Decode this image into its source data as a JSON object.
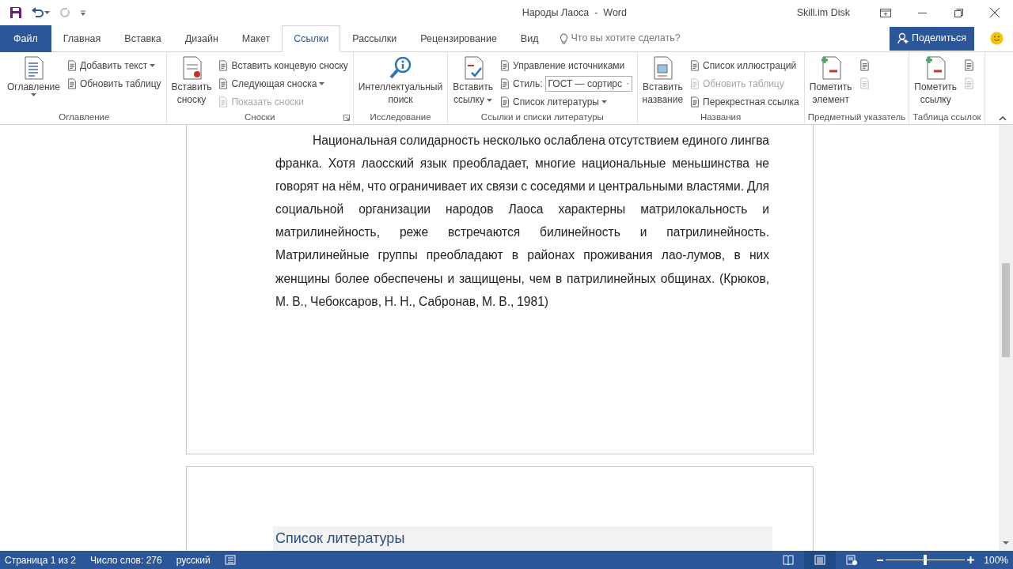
{
  "window": {
    "title": "Народы Лаоса  -  Word",
    "account": "Skill.im Disk"
  },
  "tabs": [
    {
      "label": "Файл",
      "kind": "file",
      "selected": false
    },
    {
      "label": "Главная",
      "kind": "tab",
      "selected": false
    },
    {
      "label": "Вставка",
      "kind": "tab",
      "selected": false
    },
    {
      "label": "Дизайн",
      "kind": "tab",
      "selected": false
    },
    {
      "label": "Макет",
      "kind": "tab",
      "selected": false
    },
    {
      "label": "Ссылки",
      "kind": "tab",
      "selected": true
    },
    {
      "label": "Рассылки",
      "kind": "tab",
      "selected": false
    },
    {
      "label": "Рецензирование",
      "kind": "tab",
      "selected": false
    },
    {
      "label": "Вид",
      "kind": "tab",
      "selected": false
    }
  ],
  "tell_me": {
    "placeholder": "Что вы хотите сделать?"
  },
  "share_button": "Поделиться",
  "ribbon": [
    {
      "label": "Оглавление",
      "launcher": false,
      "columns": [
        {
          "kind": "large",
          "label": "Оглавление",
          "dropdown": true,
          "disabled": false
        },
        {
          "kind": "stack",
          "items": [
            {
              "label": "Добавить текст",
              "dropdown": true,
              "disabled": false
            },
            {
              "label": "Обновить таблицу",
              "dropdown": false,
              "disabled": false
            }
          ]
        }
      ]
    },
    {
      "label": "Сноски",
      "launcher": true,
      "columns": [
        {
          "kind": "large",
          "label": "Вставить\nсноску",
          "dropdown": false,
          "disabled": false
        },
        {
          "kind": "stack",
          "items": [
            {
              "label": "Вставить концевую сноску",
              "dropdown": false,
              "disabled": false
            },
            {
              "label": "Следующая сноска",
              "dropdown": true,
              "disabled": false
            },
            {
              "label": "Показать сноски",
              "dropdown": false,
              "disabled": true
            }
          ]
        }
      ]
    },
    {
      "label": "Исследование",
      "launcher": false,
      "columns": [
        {
          "kind": "large",
          "label": "Интеллектуальный\nпоиск",
          "dropdown": false,
          "disabled": false
        }
      ]
    },
    {
      "label": "Ссылки и списки литературы",
      "launcher": false,
      "columns": [
        {
          "kind": "large",
          "label": "Вставить\nссылку",
          "dropdown": true,
          "disabled": false
        },
        {
          "kind": "stack",
          "items": [
            {
              "label": "Управление источниками",
              "dropdown": false,
              "disabled": false
            },
            {
              "label": "Стиль:",
              "kind": "combo",
              "value": "ГОСТ — сортирс"
            },
            {
              "label": "Список литературы",
              "dropdown": true,
              "disabled": false
            }
          ]
        }
      ]
    },
    {
      "label": "Названия",
      "launcher": false,
      "columns": [
        {
          "kind": "large",
          "label": "Вставить\nназвание",
          "dropdown": false,
          "disabled": false
        },
        {
          "kind": "stack",
          "items": [
            {
              "label": "Список иллюстраций",
              "dropdown": false,
              "disabled": false
            },
            {
              "label": "Обновить таблицу",
              "dropdown": false,
              "disabled": true
            },
            {
              "label": "Перекрестная ссылка",
              "dropdown": false,
              "disabled": false
            }
          ]
        }
      ]
    },
    {
      "label": "Предметный указатель",
      "launcher": false,
      "columns": [
        {
          "kind": "large",
          "label": "Пометить\nэлемент",
          "dropdown": false,
          "disabled": false
        },
        {
          "kind": "icons",
          "items": [
            {
              "disabled": false
            },
            {
              "disabled": true
            }
          ]
        }
      ]
    },
    {
      "label": "Таблица ссылок",
      "launcher": false,
      "columns": [
        {
          "kind": "large",
          "label": "Пометить\nссылку",
          "dropdown": false,
          "disabled": false
        },
        {
          "kind": "icons",
          "items": [
            {
              "disabled": false
            },
            {
              "disabled": true
            }
          ]
        }
      ]
    }
  ],
  "document": {
    "paragraph": "Национальная солидарность несколько ослаблена отсутствием единого лингва франка. Хотя лаосский язык преобладает, многие национальные меньшинства не говорят на нём, что ограничивает их связи с соседями и центральными властями. Для социальной организации народов Лаоса характерны матрилокальность и матрилинейность, реже встречаются билинейность и патрилинейность. Матрилинейные группы преобладают в районах проживания лао-лумов, в них женщины более обеспечены и защищены, чем в патрилинейных общинах. (Крюков, М. В., Чебоксаров, Н. Н., Сабронав, М. В., 1981)",
    "next_page_heading": "Список литературы"
  },
  "status_bar": {
    "items": [
      "Страница 1 из 2",
      "Число слов: 276",
      "русский"
    ],
    "views": [
      {
        "selected": false
      },
      {
        "selected": true
      },
      {
        "selected": false
      }
    ],
    "zoom": {
      "level": 0.5,
      "reading": "100%"
    }
  }
}
